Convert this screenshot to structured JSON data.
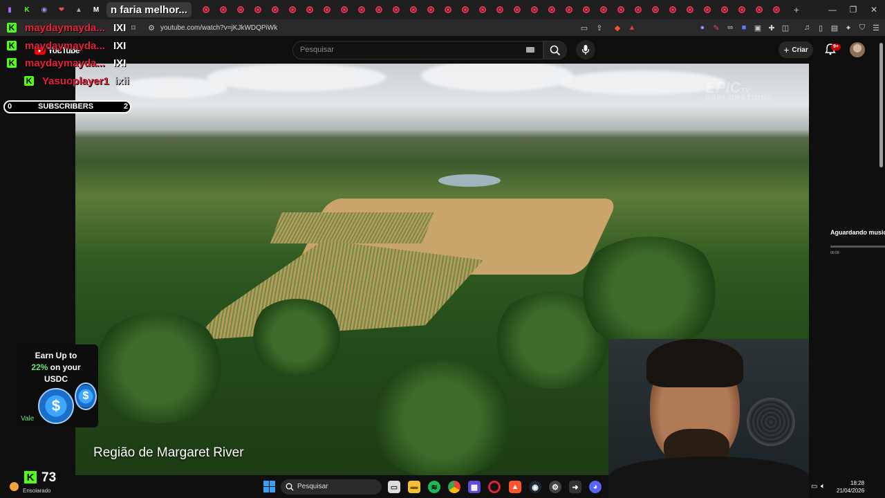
{
  "browser": {
    "active_tab_title": "n faria melhor...",
    "url": "youtube.com/watch?v=jKJkWDQPiWk",
    "new_tab": "+",
    "window_controls": [
      "minimize",
      "maximize",
      "close"
    ]
  },
  "youtube": {
    "logo": "YouTube",
    "search_placeholder": "Pesquisar",
    "create_label": "Criar",
    "notification_count": "9+"
  },
  "video": {
    "watermark": "EPIC",
    "watermark_suffix": "TV",
    "watermark_sub": "EXPLORATIONS",
    "caption": "Região de Margaret River"
  },
  "stream_overlay": {
    "chat_rows": [
      {
        "user": "maydaymayda...",
        "tag": "IXI"
      },
      {
        "user": "maydaymayda...",
        "tag": "IXI"
      },
      {
        "user": "maydaymayda...",
        "tag": "IXI"
      },
      {
        "user": "Yasuoplayer1",
        "tag": "ixii"
      }
    ],
    "subscribers_left": "0",
    "subscribers_label": "SUBSCRIBERS",
    "subscribers_right": "2",
    "ad_line1": "Earn Up to",
    "ad_pct": "22%",
    "ad_line2_rest": " on your",
    "ad_line3": "USDC",
    "ad_vale": "Vale",
    "kick_count": "73"
  },
  "music_widget": {
    "label": "Aguardando musica...",
    "time": "00:00"
  },
  "taskbar": {
    "weather": "Ensolarado",
    "search_placeholder": "Pesquisar",
    "time": "18:28",
    "date": "21/04/2026"
  },
  "colors": {
    "kick_green": "#53fc18",
    "youtube_red": "#ff0000",
    "chat_red": "#e3223a"
  }
}
